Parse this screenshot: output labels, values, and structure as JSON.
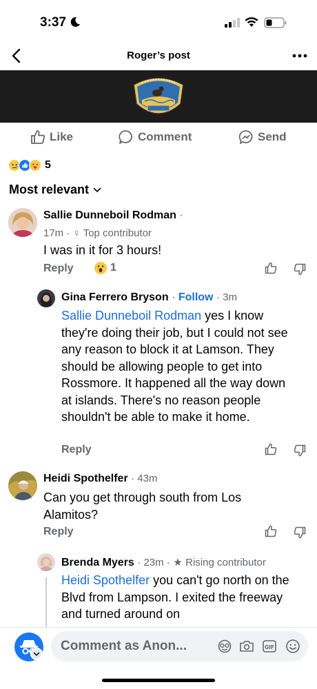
{
  "status": {
    "time": "3:37"
  },
  "header": {
    "title": "Roger’s post"
  },
  "actions": {
    "like": "Like",
    "comment": "Comment",
    "send": "Send"
  },
  "reactions": {
    "count": "5"
  },
  "sort": {
    "label": "Most relevant"
  },
  "comments": [
    {
      "name": "Sallie Dunneboil Rodman",
      "sep": "·",
      "time": "17m",
      "badge": "Top contributor",
      "text": "I was in it for 3 hours!",
      "reply": "Reply",
      "reaction_count": "1"
    },
    {
      "name": "Gina Ferrero Bryson",
      "sep": "·",
      "follow": "Follow",
      "time": "· 3m",
      "mention": "Sallie Dunneboil Rodman",
      "text": " yes I know they're doing their job, but I could not see any reason to block it at Lamson. They should be allowing people to get into Rossmore. It happened all the way down at islands. There's no reason people shouldn't be able to make it home.",
      "reply": "Reply"
    },
    {
      "name": "Heidi Spothelfer",
      "time": "· 43m",
      "text": "Can you get through south from Los Alamitos?",
      "reply": "Reply"
    },
    {
      "name": "Brenda Myers",
      "time": "· 23m ·",
      "badge": "Rising contributor",
      "mention": "Heidi Spothelfer",
      "text": " you can't go north on the Blvd from Lampson. I exited the freeway and turned around on"
    }
  ],
  "composer": {
    "placeholder": "Comment as Anon..."
  },
  "colors": {
    "accent": "#1a6ed8",
    "muted": "#65676b",
    "banner": "#1c1c1c"
  }
}
